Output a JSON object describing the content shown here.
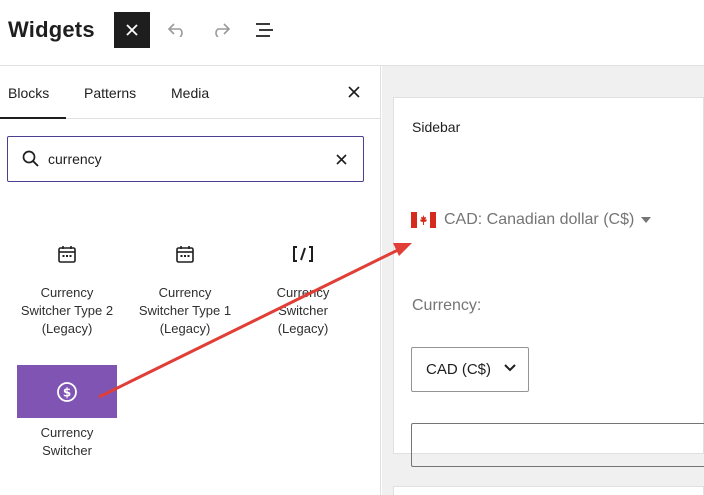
{
  "header": {
    "title": "Widgets"
  },
  "toolbar": {
    "close_icon": "close-icon",
    "undo_icon": "undo-icon",
    "redo_icon": "redo-icon",
    "list_view_icon": "list-view-icon"
  },
  "inserter": {
    "tabs": [
      {
        "label": "Blocks",
        "active": true
      },
      {
        "label": "Patterns",
        "active": false
      },
      {
        "label": "Media",
        "active": false
      }
    ],
    "search": {
      "value": "currency"
    },
    "blocks": [
      {
        "label": "Currency Switcher Type 2 (Legacy)",
        "icon": "calendar-icon"
      },
      {
        "label": "Currency Switcher Type 1 (Legacy)",
        "icon": "calendar-icon"
      },
      {
        "label": "Currency Switcher (Legacy)",
        "icon": "shortcode-icon"
      },
      {
        "label": "Currency Switcher",
        "icon": "dollar-circle-icon",
        "highlighted": true
      }
    ]
  },
  "canvas": {
    "sidebar": {
      "title": "Sidebar",
      "currency_dropdown": "CAD: Canadian dollar (C$)",
      "currency_label": "Currency:",
      "currency_select_value": "CAD (C$)"
    }
  },
  "colors": {
    "accent": "#7f54b3",
    "focus_border": "#4c3f8f",
    "annotation_arrow": "#e03e36",
    "dark": "#1e1e1e",
    "muted": "#757575",
    "canvas_bg": "#f0f0f0"
  }
}
